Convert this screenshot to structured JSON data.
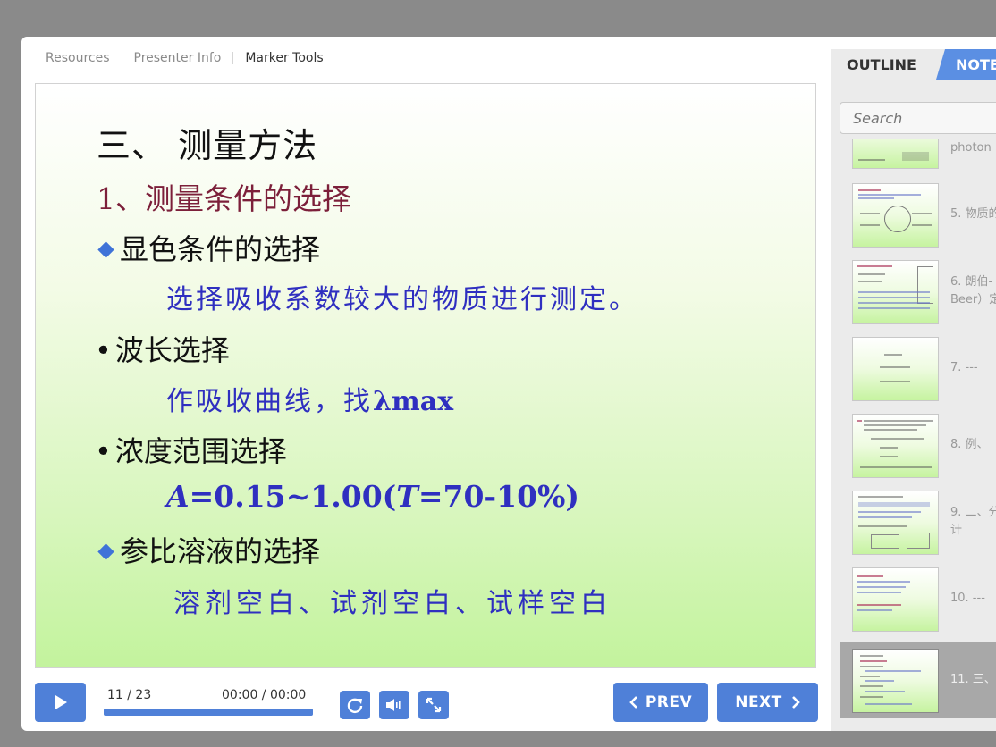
{
  "nav": {
    "resources": "Resources",
    "presenter_info": "Presenter Info",
    "marker_tools": "Marker Tools"
  },
  "slide": {
    "title": "三、 测量方法",
    "subtitle": "1、测量条件的选择",
    "items": [
      {
        "head": "显色条件的选择",
        "detail": "选择吸收系数较大的物质进行测定。"
      },
      {
        "head": "波长选择",
        "detail_prefix": "作吸收曲线，找",
        "detail_math": "λmax"
      },
      {
        "head": "浓度范围选择",
        "detail_A": "A",
        "detail_mid": "=0.15~1.00(",
        "detail_T": "T",
        "detail_end": "=70-10%)"
      },
      {
        "head": "参比溶液的选择",
        "detail": "溶剂空白、试剂空白、试样空白"
      }
    ]
  },
  "controls": {
    "slide_counter": "11 / 23",
    "time": "00:00 / 00:00",
    "progress": 1.0,
    "prev_label": "PREV",
    "next_label": "NEXT"
  },
  "sidebar": {
    "tab_outline": "OUTLINE",
    "tab_notes": "NOTE",
    "search_placeholder": "Search",
    "items": [
      {
        "label": "photon"
      },
      {
        "label": "5. 物质的"
      },
      {
        "label": "6. 朗伯-\nBeer）定"
      },
      {
        "label": "7. ---"
      },
      {
        "label": "8. 例、"
      },
      {
        "label": "9. 二、分\n计"
      },
      {
        "label": "10. ---"
      },
      {
        "label": "11. 三、"
      }
    ],
    "active_index": 7
  },
  "colors": {
    "accent": "#4f80d8",
    "slide_title": "#111111",
    "slide_subtitle": "#7c1f3a",
    "slide_blue_text": "#2f2fc0",
    "active_row": "#a8a8a8"
  }
}
